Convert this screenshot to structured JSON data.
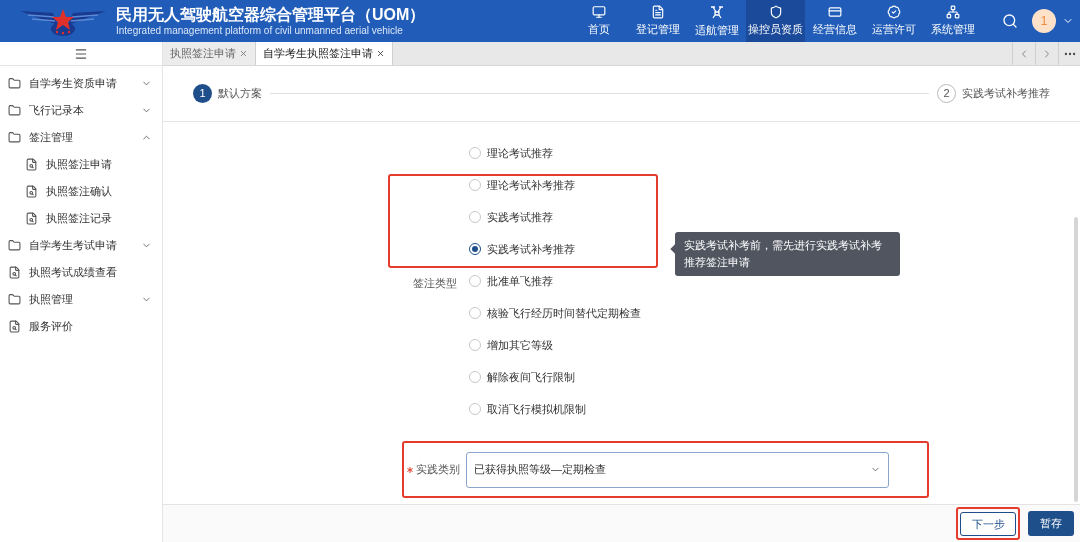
{
  "header": {
    "title": "民用无人驾驶航空器综合管理平台（UOM）",
    "subtitle": "Integrated management platform of civil unmanned aerial vehicle",
    "nav": [
      {
        "label": "首页",
        "selected": false
      },
      {
        "label": "登记管理",
        "selected": false
      },
      {
        "label": "适航管理",
        "selected": false
      },
      {
        "label": "操控员资质",
        "selected": true
      },
      {
        "label": "经营信息",
        "selected": false
      },
      {
        "label": "运营许可",
        "selected": false
      },
      {
        "label": "系统管理",
        "selected": false
      }
    ],
    "avatar": "1"
  },
  "tabs": [
    {
      "label": "执照签注申请",
      "selected": false
    },
    {
      "label": "自学考生执照签注申请",
      "selected": true
    }
  ],
  "sidebar": {
    "items": [
      {
        "label": "自学考生资质申请",
        "kind": "folder",
        "expanded": false
      },
      {
        "label": "飞行记录本",
        "kind": "folder",
        "expanded": false
      },
      {
        "label": "签注管理",
        "kind": "folder",
        "expanded": true,
        "children": [
          {
            "label": "执照签注申请"
          },
          {
            "label": "执照签注确认"
          },
          {
            "label": "执照签注记录"
          }
        ]
      },
      {
        "label": "自学考生考试申请",
        "kind": "folder",
        "expanded": false
      },
      {
        "label": "执照考试成绩查看",
        "kind": "page"
      },
      {
        "label": "执照管理",
        "kind": "folder",
        "expanded": false
      },
      {
        "label": "服务评价",
        "kind": "page"
      }
    ]
  },
  "steps": [
    {
      "number": "1",
      "label": "默认方案",
      "selected": true
    },
    {
      "number": "2",
      "label": "实践考试补考推荐",
      "selected": false
    }
  ],
  "form": {
    "type_label": "签注类型",
    "options": [
      {
        "label": "理论考试推荐",
        "selected": false
      },
      {
        "label": "理论考试补考推荐",
        "selected": false
      },
      {
        "label": "实践考试推荐",
        "selected": false
      },
      {
        "label": "实践考试补考推荐",
        "selected": true
      },
      {
        "label": "批准单飞推荐",
        "selected": false
      },
      {
        "label": "核验飞行经历时间替代定期检查",
        "selected": false
      },
      {
        "label": "增加其它等级",
        "selected": false
      },
      {
        "label": "解除夜间飞行限制",
        "selected": false
      },
      {
        "label": "取消飞行模拟机限制",
        "selected": false
      }
    ],
    "tooltip": "实践考试补考前，需先进行实践考试补考推荐签注申请",
    "category": {
      "label": "实践类别",
      "required": true,
      "value": "已获得执照等级—定期检查"
    }
  },
  "buttons": [
    {
      "label": "下一步",
      "kind": "outline"
    },
    {
      "label": "暂存",
      "kind": "primary"
    }
  ]
}
